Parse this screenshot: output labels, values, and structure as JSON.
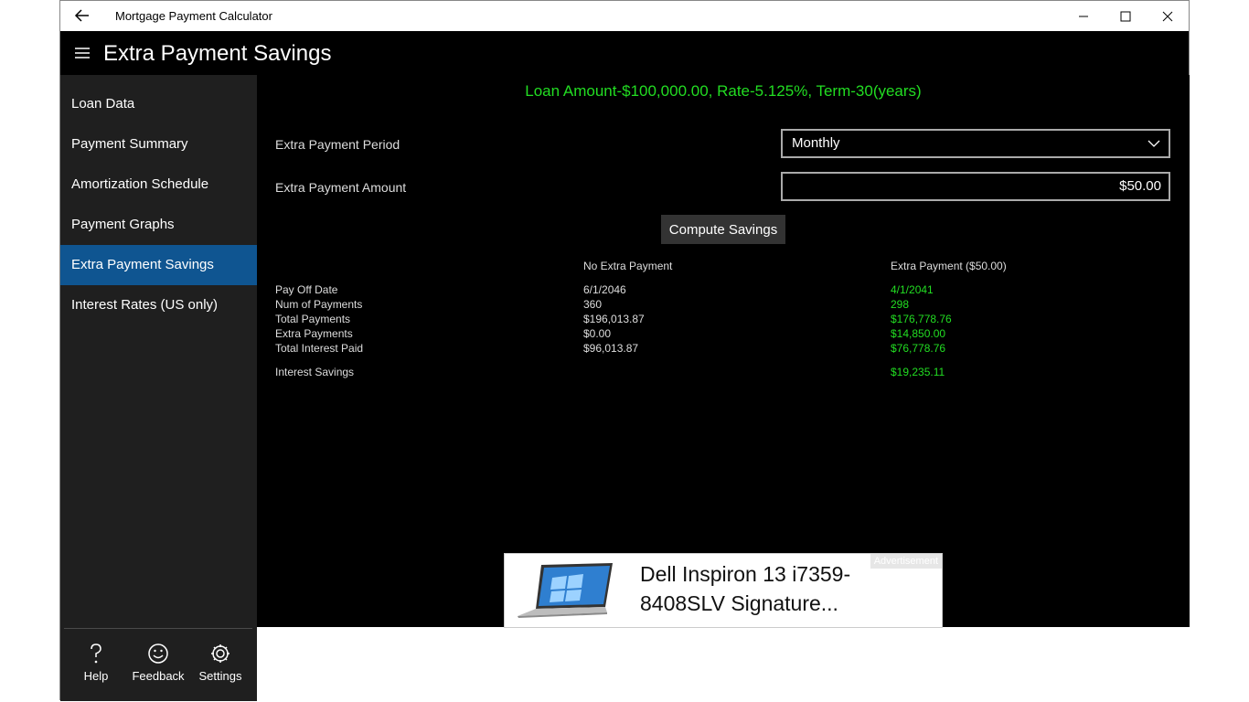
{
  "window": {
    "title": "Mortgage Payment Calculator"
  },
  "header": {
    "page_title": "Extra Payment Savings"
  },
  "sidebar": {
    "items": [
      {
        "label": "Loan Data"
      },
      {
        "label": "Payment Summary"
      },
      {
        "label": "Amortization Schedule"
      },
      {
        "label": "Payment Graphs"
      },
      {
        "label": "Extra Payment Savings",
        "active": true
      },
      {
        "label": "Interest Rates (US only)"
      }
    ],
    "bottom": [
      {
        "label": "Help",
        "icon": "help-icon"
      },
      {
        "label": "Feedback",
        "icon": "smiley-icon"
      },
      {
        "label": "Settings",
        "icon": "gear-icon"
      }
    ]
  },
  "main": {
    "loan_info": "Loan Amount-$100,000.00, Rate-5.125%, Term-30(years)",
    "period_label": "Extra Payment Period",
    "period_value": "Monthly",
    "amount_label": "Extra Payment Amount",
    "amount_value": "$50.00",
    "compute_label": "Compute Savings",
    "col_no_extra": "No Extra Payment",
    "col_extra": "Extra Payment ($50.00)",
    "rows": [
      {
        "label": "Pay Off Date",
        "no_extra": "6/1/2046",
        "extra": "4/1/2041"
      },
      {
        "label": "Num of Payments",
        "no_extra": "360",
        "extra": "298"
      },
      {
        "label": "Total Payments",
        "no_extra": "$196,013.87",
        "extra": "$176,778.76"
      },
      {
        "label": "Extra Payments",
        "no_extra": "$0.00",
        "extra": "$14,850.00"
      },
      {
        "label": "Total Interest Paid",
        "no_extra": "$96,013.87",
        "extra": "$76,778.76"
      }
    ],
    "savings_label": "Interest Savings",
    "savings_value": "$19,235.11"
  },
  "ad": {
    "text": "Dell Inspiron 13 i7359-8408SLV Signature...",
    "badge": "Advertisement"
  },
  "colors": {
    "accent": "#0f5591",
    "green": "#22dd22",
    "sidebar_bg": "#1f1f1f"
  }
}
